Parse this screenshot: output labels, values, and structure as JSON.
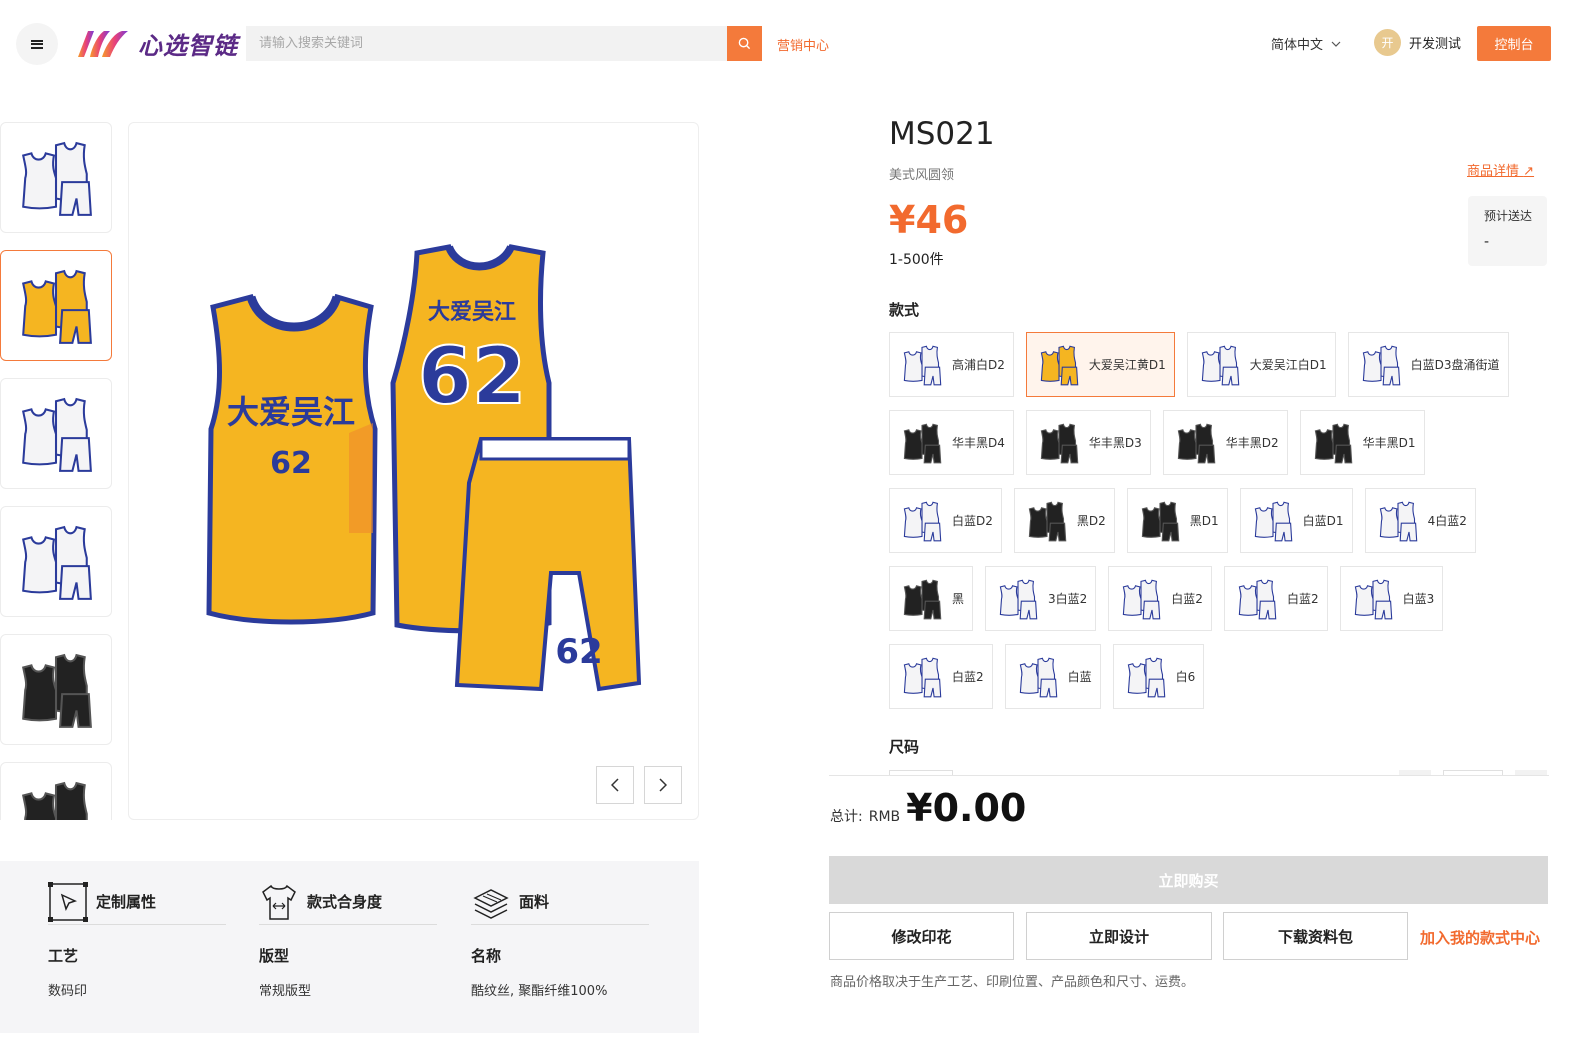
{
  "header": {
    "logo_text": "心选智链",
    "search_placeholder": "请输入搜索关键词",
    "marketing_link": "营销中心",
    "language": "简体中文",
    "avatar_initial": "开",
    "user_name": "开发测试",
    "console_button": "控制台"
  },
  "product": {
    "code": "MS021",
    "subtitle": "美式风圆领",
    "detail_link": "商品详情",
    "price": "¥46",
    "quantity_range": "1-500件",
    "eta_label": "预计送达",
    "eta_value": "-",
    "style_section": "款式",
    "size_section": "尺码"
  },
  "styles": [
    [
      {
        "label": "高浦白D2",
        "color": "white"
      },
      {
        "label": "大爱吴江黄D1",
        "color": "yellow",
        "active": true
      },
      {
        "label": "大爱吴江白D1",
        "color": "white"
      },
      {
        "label": "白蓝D3盘涌街道",
        "color": "white"
      }
    ],
    [
      {
        "label": "华丰黑D4",
        "color": "black"
      },
      {
        "label": "华丰黑D3",
        "color": "black"
      },
      {
        "label": "华丰黑D2",
        "color": "black"
      },
      {
        "label": "华丰黑D1",
        "color": "black"
      }
    ],
    [
      {
        "label": "白蓝D2",
        "color": "white"
      },
      {
        "label": "黑D2",
        "color": "black"
      },
      {
        "label": "黑D1",
        "color": "black"
      },
      {
        "label": "白蓝D1",
        "color": "white"
      },
      {
        "label": "4白蓝2",
        "color": "white"
      }
    ],
    [
      {
        "label": "黑",
        "color": "black"
      },
      {
        "label": "3白蓝2",
        "color": "white"
      },
      {
        "label": "白蓝2",
        "color": "white"
      },
      {
        "label": "白蓝2",
        "color": "white"
      },
      {
        "label": "白蓝3",
        "color": "white"
      }
    ],
    [
      {
        "label": "白蓝2",
        "color": "white"
      },
      {
        "label": "白蓝",
        "color": "white"
      },
      {
        "label": "白6",
        "color": "white"
      }
    ]
  ],
  "total": {
    "label": "总计:",
    "currency": "RMB",
    "amount": "¥0.00"
  },
  "actions": {
    "buy_now": "立即购买",
    "edit_print": "修改印花",
    "design_now": "立即设计",
    "download_pack": "下载资料包",
    "add_to_center": "加入我的款式中心",
    "note": "商品价格取决于生产工艺、印刷位置、产品颜色和尺寸、运费。"
  },
  "attributes": [
    {
      "title": "定制属性",
      "icon": "cursor-icon",
      "key": "工艺",
      "value": "数码印"
    },
    {
      "title": "款式合身度",
      "icon": "tshirt-icon",
      "key": "版型",
      "value": "常规版型"
    },
    {
      "title": "面料",
      "icon": "fabric-icon",
      "key": "名称",
      "value": "酷纹丝, 聚酯纤维100%"
    }
  ],
  "thumbnails": [
    "white",
    "yellow",
    "white",
    "white",
    "black",
    "black"
  ],
  "jersey_print": {
    "team": "大爱吴江",
    "number": "62"
  },
  "colors": {
    "accent": "#f47a3b",
    "jersey_yellow": "#f5b521",
    "jersey_blue": "#2b3b9b"
  }
}
